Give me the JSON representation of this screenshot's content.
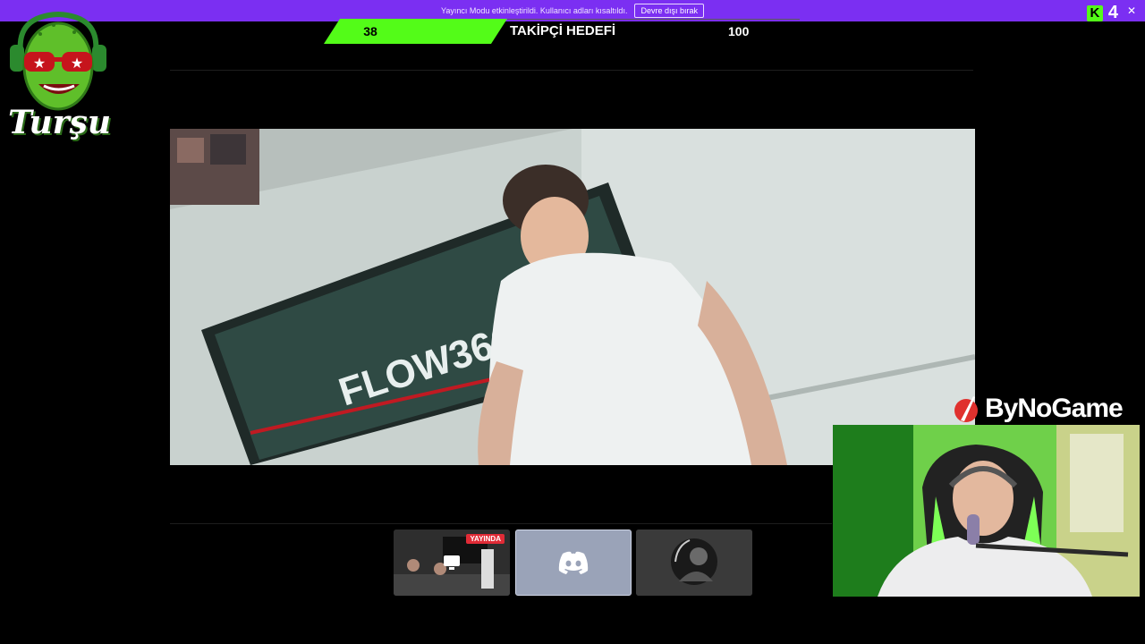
{
  "banner": {
    "message": "Yayıncı Modu etkinleştirildi. Kullanıcı adları kısaltıldı.",
    "disable_button": "Devre dışı bırak"
  },
  "kick": {
    "count": "4",
    "icon": "kick-icon",
    "close_icon": "close-icon"
  },
  "goal": {
    "current": "38",
    "label": "TAKİPÇİ HEDEFİ",
    "target": "100",
    "progress": 0.38,
    "fill_color": "#53fc18"
  },
  "logo": {
    "text": "Turşu"
  },
  "thumbnails": {
    "live_label": "YAYINDA",
    "items": [
      {
        "name": "screen-share",
        "icon": "monitor-icon"
      },
      {
        "name": "discord",
        "icon": "discord-icon"
      },
      {
        "name": "user-avatar",
        "icon": "avatar"
      }
    ]
  },
  "sponsor": {
    "name": "ByNoGame"
  },
  "colors": {
    "banner": "#7b2ff2",
    "accent_green": "#53fc18",
    "live_red": "#e02b36"
  }
}
